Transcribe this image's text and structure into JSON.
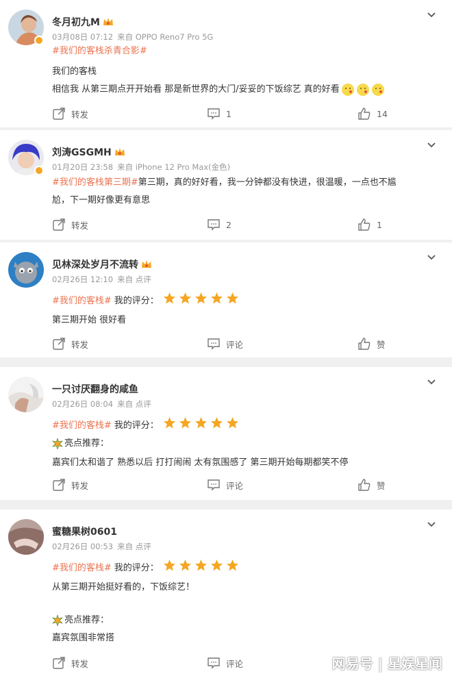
{
  "posts": [
    {
      "username": "冬月初九M",
      "date": "03月08日 07:12",
      "source": "来自 OPPO Reno7 Pro 5G",
      "lines": [
        {
          "parts": [
            {
              "tag": "#我们的客栈杀青合影#"
            }
          ]
        },
        {
          "parts": [
            {
              "text": "我们的客栈"
            }
          ]
        },
        {
          "parts": [
            {
              "text": "相信我 从第三期点开开始看 那是新世界的大门/妥妥的下饭综艺 真的好看"
            }
          ],
          "emoji": [
            "kiss-emoji",
            "kiss-emoji",
            "kiss-emoji"
          ]
        }
      ],
      "actions": {
        "forward": "转发",
        "comment": "1",
        "like": "14"
      }
    },
    {
      "username": "刘涛GSGMH",
      "date": "01月20日 23:58",
      "source": "来自 iPhone 12 Pro Max(金色)",
      "lines": [
        {
          "parts": [
            {
              "tag": "#我们的客栈第三期#"
            },
            {
              "text": "第三期，真的好好看，我一分钟都没有快进，很温暖，一点也不尴"
            }
          ]
        },
        {
          "parts": [
            {
              "text": "尬，下一期好像更有意思"
            }
          ]
        }
      ],
      "actions": {
        "forward": "转发",
        "comment": "2",
        "like": "1"
      }
    },
    {
      "username": "见林深处岁月不流转",
      "date": "02月26日 12:10",
      "source": "来自 点评",
      "rating_label": "我的评分：",
      "rating": 5,
      "lines_pre": [
        {
          "tag": "#我们的客栈#"
        }
      ],
      "lines": [
        {
          "parts": [
            {
              "text": "第三期开始 很好看"
            }
          ]
        }
      ],
      "actions": {
        "forward": "转发",
        "comment": "评论",
        "like": "赞"
      }
    },
    {
      "username": "一只讨厌翻身的咸鱼",
      "date": "02月26日 08:04",
      "source": "来自 点评",
      "rating_label": "我的评分：",
      "rating": 5,
      "lines_pre": [
        {
          "tag": "#我们的客栈#"
        }
      ],
      "highlight_label": "亮点推荐：",
      "lines": [
        {
          "parts": [
            {
              "text": "嘉宾们太和谐了 熟悉以后 打打闹闹 太有氛围感了 第三期开始每期都笑不停"
            }
          ]
        }
      ],
      "actions": {
        "forward": "转发",
        "comment": "评论",
        "like": "赞"
      }
    },
    {
      "username": "蜜糖果树0601",
      "date": "02月26日 00:53",
      "source": "来自 点评",
      "rating_label": "我的评分：",
      "rating": 5,
      "lines_pre": [
        {
          "tag": "#我们的客栈#"
        }
      ],
      "line_after_rating": "从第三期开始挺好看的，下饭综艺！",
      "highlight_label": "亮点推荐：",
      "lines": [
        {
          "parts": [
            {
              "text": "嘉宾氛围非常搭"
            }
          ]
        }
      ],
      "actions": {
        "forward": "转发",
        "comment": "评论",
        "like": "赞"
      }
    }
  ],
  "watermark": "网易号 | 星娱星闻",
  "colors": {
    "tag": "#eb7350",
    "star": "#f5a623",
    "badge": "#f5a623"
  }
}
